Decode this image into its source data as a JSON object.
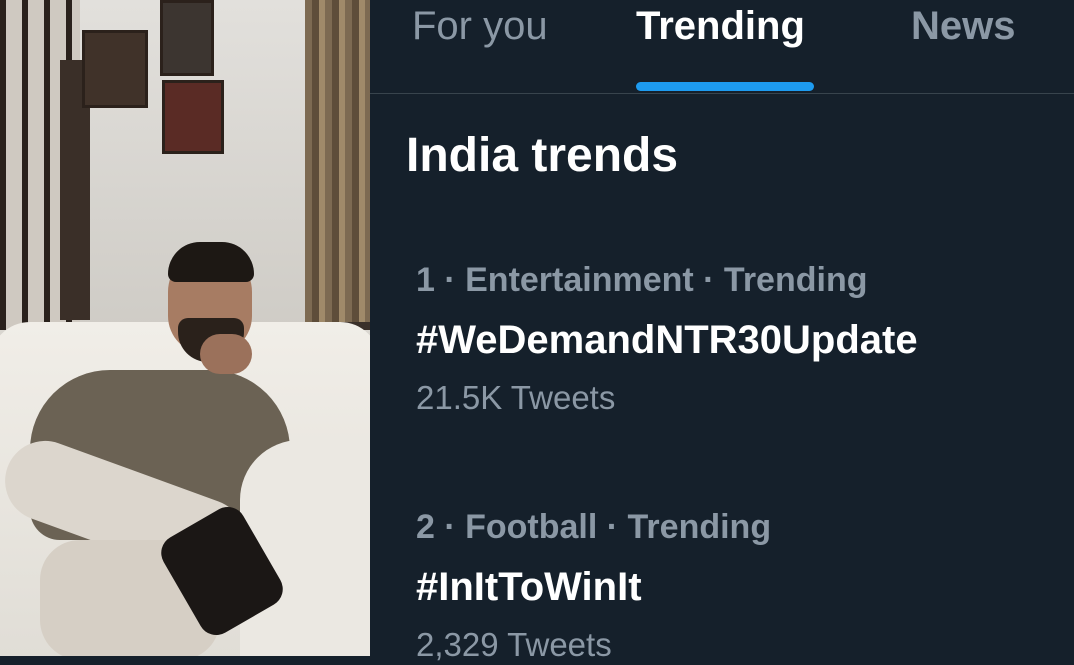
{
  "tabs": [
    {
      "label": "For you",
      "active": false
    },
    {
      "label": "Trending",
      "active": true
    },
    {
      "label": "News",
      "active": false
    }
  ],
  "section": {
    "title": "India trends"
  },
  "trends": [
    {
      "rank": "1",
      "category": "Entertainment",
      "status": "Trending",
      "meta": "1 · Entertainment · Trending",
      "name": "#WeDemandNTR30Update",
      "count": "21.5K Tweets"
    },
    {
      "rank": "2",
      "category": "Football",
      "status": "Trending",
      "meta": "2 · Football · Trending",
      "name": "#InItToWinIt",
      "count": "2,329 Tweets"
    }
  ],
  "colors": {
    "background": "#15202b",
    "accent": "#1d9bf0",
    "secondary_text": "#8b98a5",
    "primary_text": "#ffffff",
    "divider": "#38444d"
  }
}
